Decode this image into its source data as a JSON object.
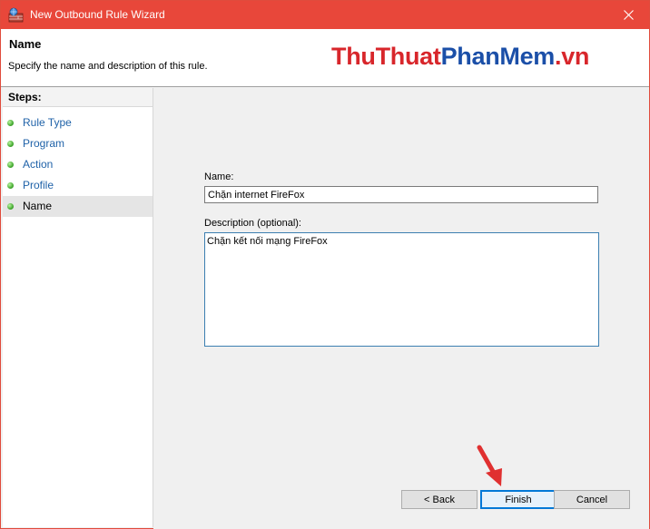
{
  "window": {
    "title": "New Outbound Rule Wizard",
    "close_glyph": "✕",
    "accent_color": "#e8473a"
  },
  "header": {
    "heading": "Name",
    "subheading": "Specify the name and description of this rule.",
    "watermark_part1": "ThuThuat",
    "watermark_part2": "PhanMem",
    "watermark_part3": ".vn"
  },
  "steps": {
    "title": "Steps:",
    "items": [
      {
        "label": "Rule Type"
      },
      {
        "label": "Program"
      },
      {
        "label": "Action"
      },
      {
        "label": "Profile"
      },
      {
        "label": "Name",
        "current": true
      }
    ]
  },
  "form": {
    "name_label": "Name:",
    "name_value": "Chặn internet FireFox",
    "description_label": "Description (optional):",
    "description_value": "Chặn kết nối mạng FireFox"
  },
  "buttons": {
    "back": "< Back",
    "finish": "Finish",
    "cancel": "Cancel"
  },
  "icons": {
    "app": "firewall-icon",
    "close": "close-icon",
    "step_status": "green-dot-icon",
    "annotation": "red-arrow-icon"
  }
}
